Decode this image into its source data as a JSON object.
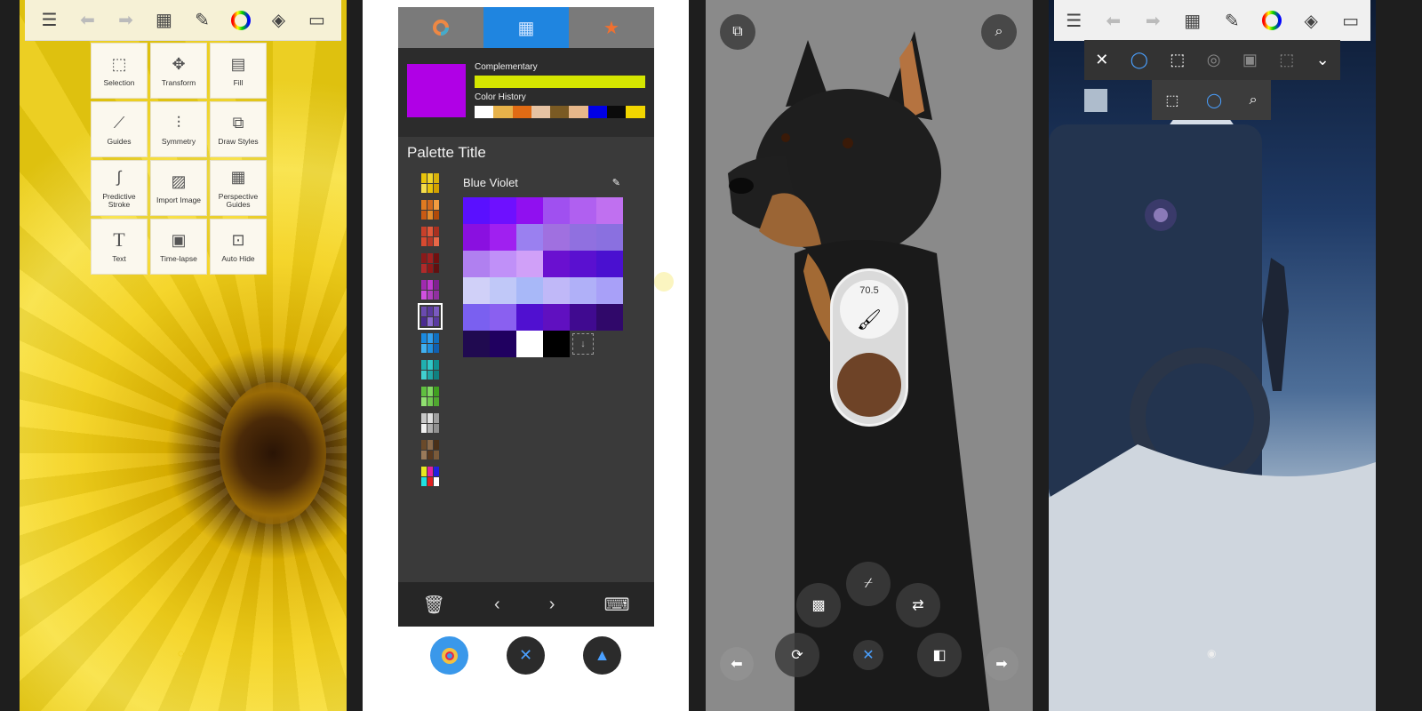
{
  "panel1": {
    "toolbar_icons": [
      "list-icon",
      "undo-icon",
      "redo-icon",
      "grid-icon",
      "brushes-icon",
      "color-wheel-icon",
      "layers-icon",
      "fullscreen-icon"
    ],
    "tools": [
      {
        "icon": "selection-icon",
        "label": "Selection"
      },
      {
        "icon": "transform-icon",
        "label": "Transform"
      },
      {
        "icon": "fill-icon",
        "label": "Fill"
      },
      {
        "icon": "guides-icon",
        "label": "Guides"
      },
      {
        "icon": "symmetry-icon",
        "label": "Symmetry"
      },
      {
        "icon": "draw-styles-icon",
        "label": "Draw Styles"
      },
      {
        "icon": "predictive-stroke-icon",
        "label": "Predictive Stroke"
      },
      {
        "icon": "import-image-icon",
        "label": "Import Image"
      },
      {
        "icon": "perspective-guides-icon",
        "label": "Perspective Guides"
      },
      {
        "icon": "text-icon",
        "label": "Text"
      },
      {
        "icon": "time-lapse-icon",
        "label": "Time-lapse"
      },
      {
        "icon": "auto-hide-icon",
        "label": "Auto Hide"
      }
    ]
  },
  "panel2": {
    "tabs": [
      "color-wheel-icon",
      "palette-grid-icon",
      "star-icon"
    ],
    "current_color": "#b000e6",
    "complementary_label": "Complementary",
    "complementary_color": "#d4e600",
    "history_label": "Color History",
    "history": [
      "#ffffff",
      "#e7b24a",
      "#e06b14",
      "#e6c3a3",
      "#7a5a23",
      "#e6b78a",
      "#0000e6",
      "#0b0b0b",
      "#f2d600"
    ],
    "palette_title": "Palette Title",
    "palette_name": "Blue Violet",
    "palettes_mini": [
      [
        "#e8c40a",
        "#f0d52a",
        "#d9b20a",
        "#f4dd4a",
        "#e8c40a",
        "#d1a000"
      ],
      [
        "#e07a20",
        "#d2691e",
        "#f29b40",
        "#c85a14",
        "#e48a2a",
        "#b04a0a"
      ],
      [
        "#c8402a",
        "#e0583a",
        "#a83020",
        "#d84a30",
        "#b83828",
        "#e86848"
      ],
      [
        "#8a1a1a",
        "#a02020",
        "#701010",
        "#b02a2a",
        "#901818",
        "#601010"
      ],
      [
        "#a02ab0",
        "#c03ad0",
        "#802090",
        "#d050e0",
        "#b040c0",
        "#9030a0"
      ],
      [
        "#6a4ab0",
        "#5a3aa0",
        "#7a5ac0",
        "#4a2a90",
        "#8a6ad0",
        "#5a3aa0"
      ],
      [
        "#1a8ae0",
        "#30a0f0",
        "#1070c0",
        "#40b0f0",
        "#2090e0",
        "#1060b0"
      ],
      [
        "#20b0b0",
        "#30c8c8",
        "#109090",
        "#40d0d0",
        "#20a8a8",
        "#108080"
      ],
      [
        "#60c040",
        "#80d860",
        "#40a020",
        "#90e070",
        "#70c850",
        "#50a830"
      ],
      [
        "#c8c8c8",
        "#e0e0e0",
        "#a0a0a0",
        "#f0f0f0",
        "#b0b0b0",
        "#909090"
      ],
      [
        "#6a4a2a",
        "#8a6a4a",
        "#4a3018",
        "#9a7a5a",
        "#5a3a20",
        "#7a5a3a"
      ],
      [
        "#e8e820",
        "#e020a0",
        "#2020e0",
        "#20e0e0",
        "#e02020",
        "#ffffff"
      ]
    ],
    "selected_mini_index": 5,
    "big_palette": [
      "#5a10ff",
      "#6e10ff",
      "#9010f0",
      "#a050f0",
      "#b060f0",
      "#c070f0",
      "#8a10e0",
      "#a020f0",
      "#9a80f0",
      "#a070e0",
      "#9070e0",
      "#8a70e0",
      "#b080f0",
      "#c090f8",
      "#d0a0f8",
      "#6a10d0",
      "#5a10d0",
      "#4a10d0",
      "#d0d0f8",
      "#c0c8f8",
      "#a8b8f8",
      "#c0b8f8",
      "#b0b0f8",
      "#a8a0f8",
      "#7a60f0",
      "#8a60f0",
      "#5010d0",
      "#6010c0",
      "#400a90",
      "#30086a",
      "#200a50",
      "#200060",
      "#ffffff",
      "#000000",
      "empty",
      "empty"
    ],
    "bottom_icons": [
      "delete-icon",
      "prev-icon",
      "next-icon",
      "keyboard-icon"
    ],
    "bottom_buttons": [
      "color-wheel-icon",
      "close-icon",
      "eyedropper-icon"
    ]
  },
  "panel3": {
    "brush_size": "70.5",
    "brush_color": "#6e4327",
    "top_left_icon": "paste-icon",
    "top_right_icon": "zoom-icon",
    "bottom_controls": [
      "eyedropper-icon",
      "transparency-icon",
      "swap-icon",
      "rotate-icon",
      "close-icon",
      "mirror-icon",
      "undo-icon",
      "redo-icon"
    ]
  },
  "panel4": {
    "toolbar_icons": [
      "list-icon",
      "undo-icon",
      "redo-icon",
      "grid-icon",
      "brushes-icon",
      "color-wheel-icon",
      "layers-icon",
      "fullscreen-icon"
    ],
    "selection_tools": [
      "close-icon",
      "lasso-icon",
      "rect-select-icon",
      "magic-wand-icon",
      "invert-select-icon",
      "deselect-icon",
      "more-icon"
    ],
    "selection_modes": [
      "rect-marquee-icon",
      "lasso-marquee-icon",
      "magic-wand-marquee-icon"
    ]
  }
}
